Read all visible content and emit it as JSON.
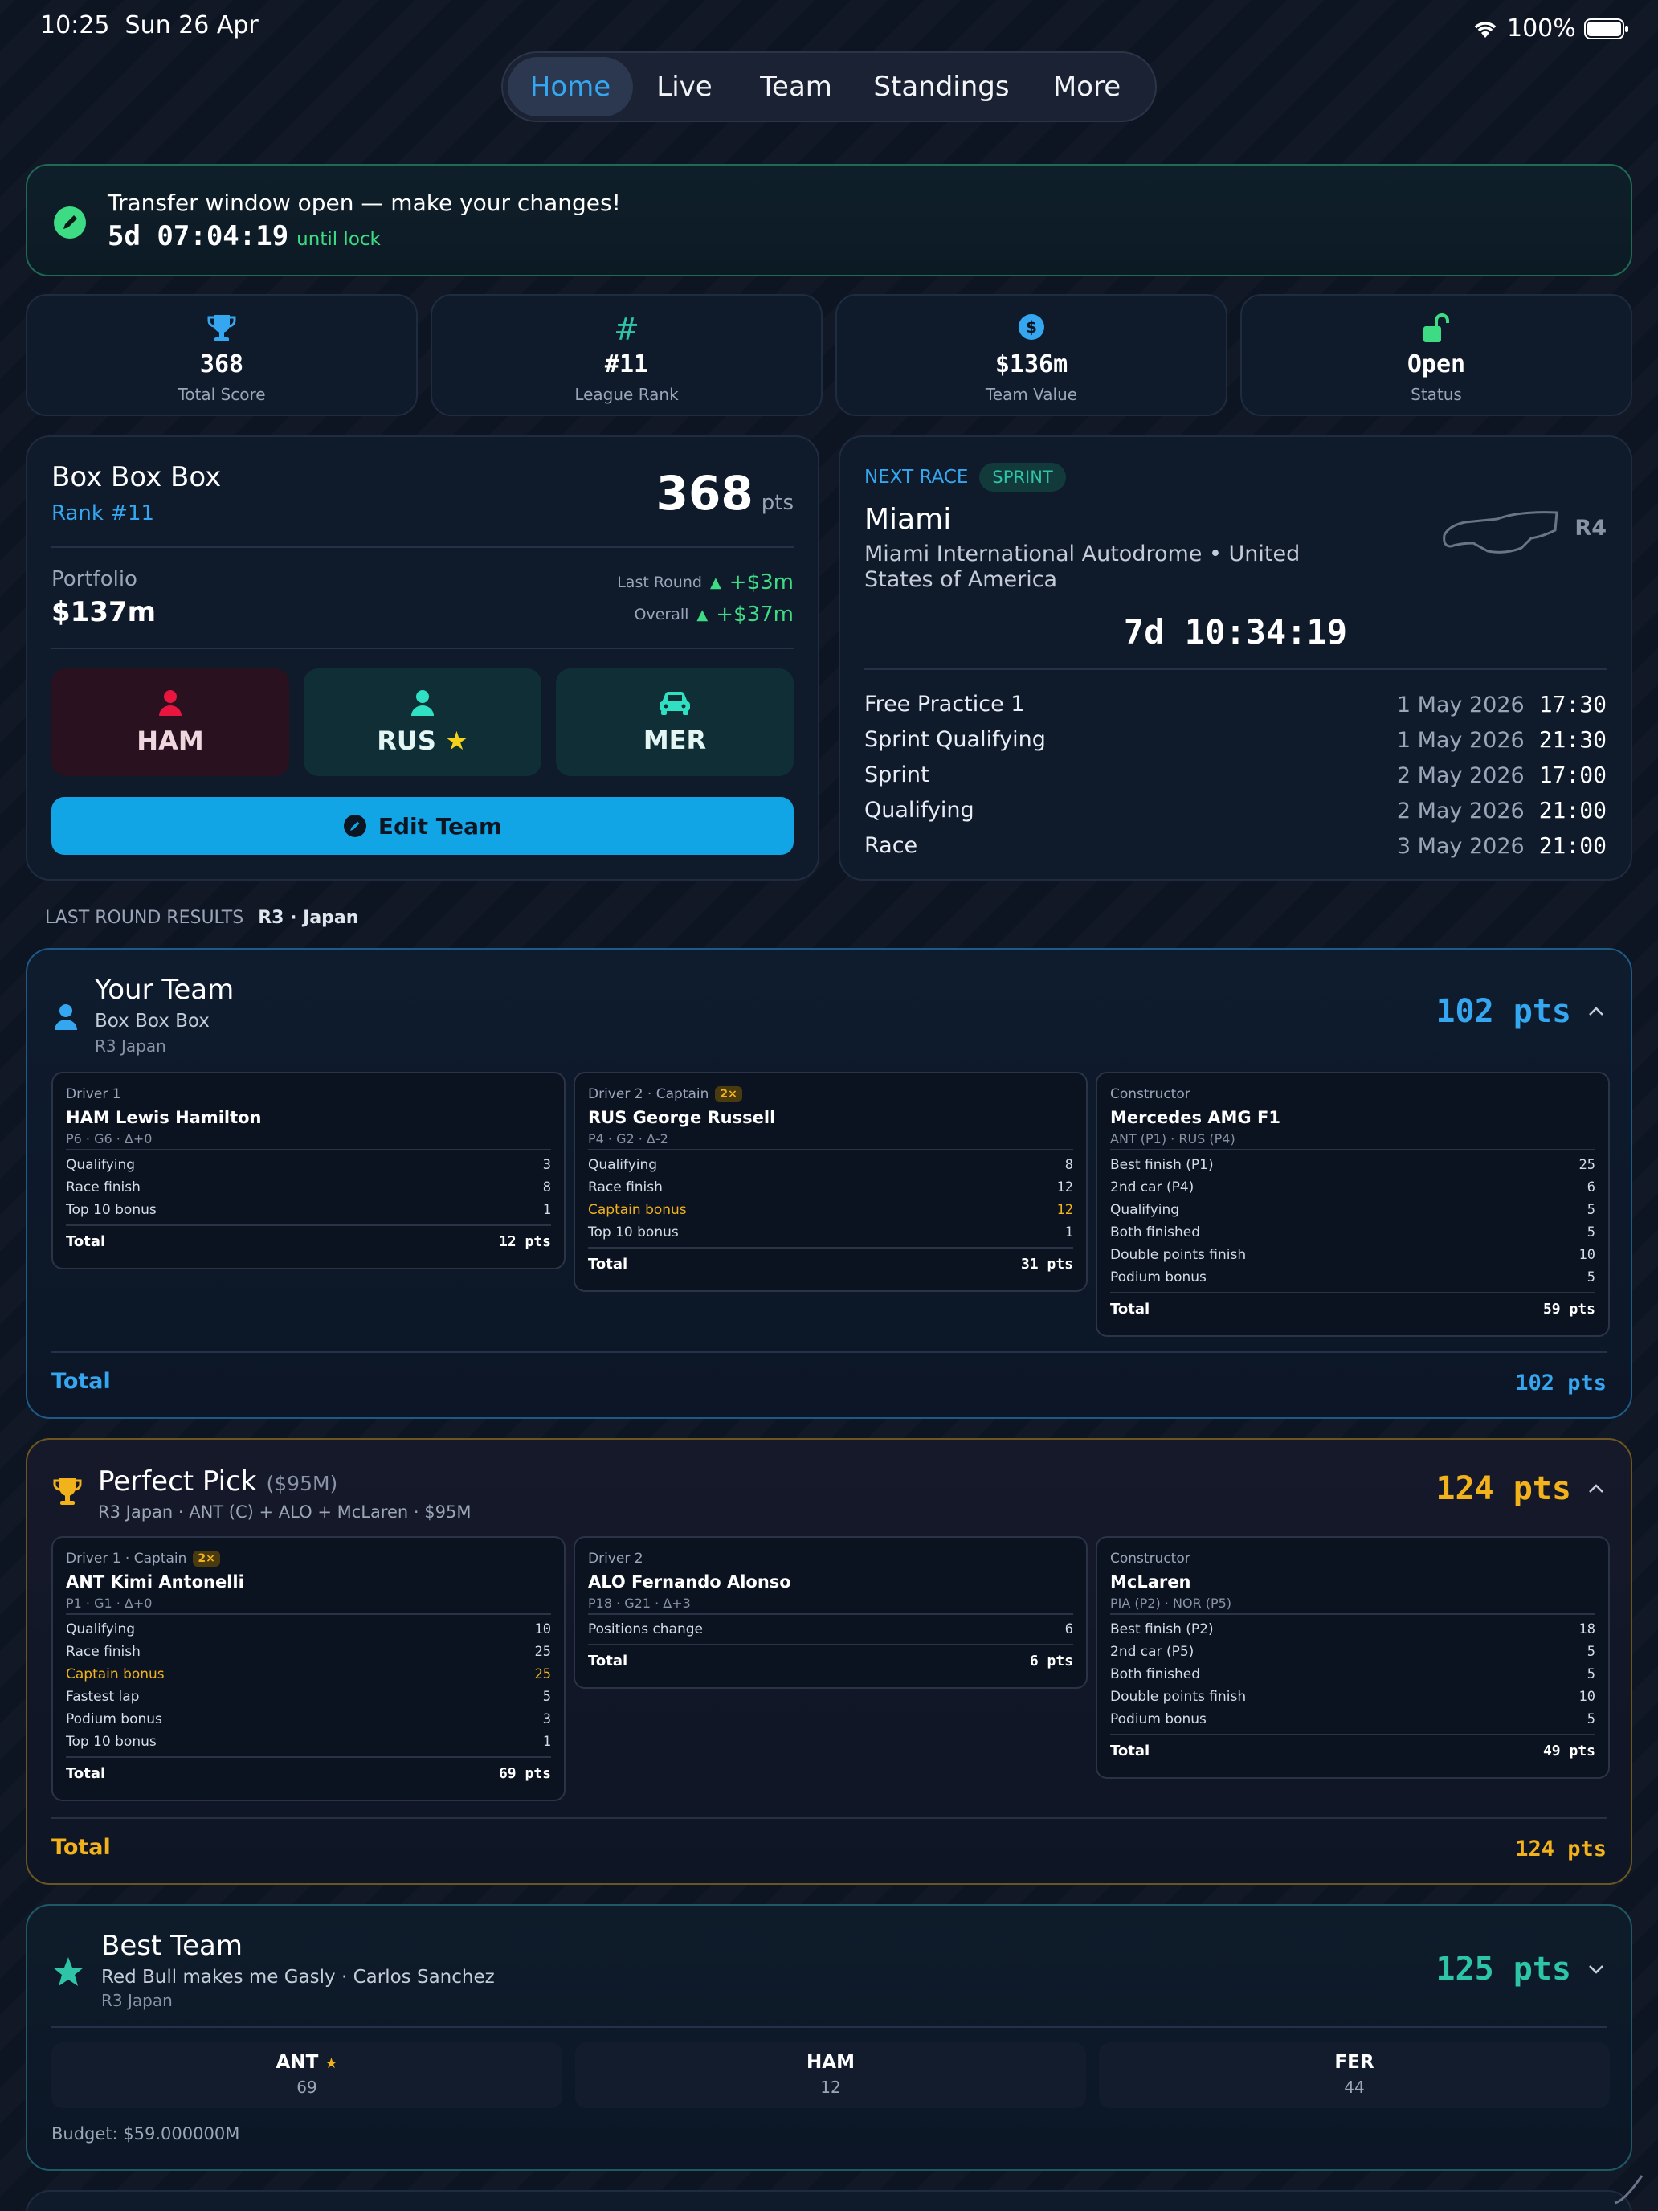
{
  "status_bar": {
    "time": "10:25",
    "date": "Sun 26 Apr",
    "battery": "100%"
  },
  "tabs": [
    {
      "label": "Home",
      "active": true
    },
    {
      "label": "Live"
    },
    {
      "label": "Team"
    },
    {
      "label": "Standings"
    },
    {
      "label": "More"
    }
  ],
  "transfer": {
    "message": "Transfer window open — make your changes!",
    "countdown": "5d 07:04:19",
    "suffix": "until lock"
  },
  "stats": [
    {
      "value": "368",
      "label": "Total Score",
      "icon": "trophy-icon"
    },
    {
      "value": "#11",
      "label": "League Rank",
      "icon": "hash-icon"
    },
    {
      "value": "$136m",
      "label": "Team Value",
      "icon": "dollar-icon"
    },
    {
      "value": "Open",
      "label": "Status",
      "icon": "unlock-icon"
    }
  ],
  "team_card": {
    "name": "Box Box Box",
    "rank": "Rank #11",
    "points": "368",
    "points_unit": "pts",
    "portfolio_label": "Portfolio",
    "portfolio_value": "$137m",
    "last_round_label": "Last Round",
    "last_round_value": "+$3m",
    "overall_label": "Overall",
    "overall_value": "+$37m",
    "chips": [
      {
        "code": "HAM",
        "icon": "person-icon"
      },
      {
        "code": "RUS",
        "icon": "person-icon",
        "captain": "★"
      },
      {
        "code": "MER",
        "icon": "car-icon"
      }
    ],
    "edit_label": "Edit Team"
  },
  "next_race": {
    "label": "NEXT RACE",
    "badge": "SPRINT",
    "name": "Miami",
    "venue": "Miami International Autodrome • United States of America",
    "round": "R4",
    "countdown": "7d 10:34:19",
    "sessions": [
      {
        "name": "Free Practice 1",
        "date": "1 May 2026",
        "time": "17:30"
      },
      {
        "name": "Sprint Qualifying",
        "date": "1 May 2026",
        "time": "21:30"
      },
      {
        "name": "Sprint",
        "date": "2 May 2026",
        "time": "17:00"
      },
      {
        "name": "Qualifying",
        "date": "2 May 2026",
        "time": "21:00"
      },
      {
        "name": "Race",
        "date": "3 May 2026",
        "time": "21:00"
      }
    ]
  },
  "last_round": {
    "label": "LAST ROUND RESULTS",
    "value": "R3 · Japan"
  },
  "your_team": {
    "title": "Your Team",
    "subtitle": "Box Box Box",
    "round": "R3 Japan",
    "points": "102 pts",
    "total_label": "Total",
    "total_value": "102 pts",
    "cards": [
      {
        "head": "Driver 1",
        "name": "HAM Lewis Hamilton",
        "meta": "P6 · G6 · Δ+0",
        "rows": [
          [
            "Qualifying",
            "3"
          ],
          [
            "Race finish",
            "8"
          ],
          [
            "Top 10 bonus",
            "1"
          ]
        ],
        "total": "12 pts"
      },
      {
        "head": "Driver 2 · Captain",
        "badge": "2×",
        "name": "RUS George Russell",
        "meta": "P4 · G2 · Δ-2",
        "rows": [
          [
            "Qualifying",
            "8"
          ],
          [
            "Race finish",
            "12"
          ],
          [
            "Captain bonus",
            "12"
          ],
          [
            "Top 10 bonus",
            "1"
          ]
        ],
        "total": "31 pts"
      },
      {
        "head": "Constructor",
        "name": "Mercedes AMG F1",
        "meta": "ANT (P1) · RUS (P4)",
        "rows": [
          [
            "Best finish (P1)",
            "25"
          ],
          [
            "2nd car (P4)",
            "6"
          ],
          [
            "Qualifying",
            "5"
          ],
          [
            "Both finished",
            "5"
          ],
          [
            "Double points finish",
            "10"
          ],
          [
            "Podium bonus",
            "5"
          ]
        ],
        "total": "59 pts"
      }
    ]
  },
  "perfect_pick": {
    "title": "Perfect Pick",
    "budget": "($95M)",
    "subtitle": "R3 Japan · ANT (C) + ALO + McLaren · $95M",
    "points": "124 pts",
    "total_label": "Total",
    "total_value": "124 pts",
    "cards": [
      {
        "head": "Driver 1 · Captain",
        "badge": "2×",
        "name": "ANT Kimi Antonelli",
        "meta": "P1 · G1 · Δ+0",
        "rows": [
          [
            "Qualifying",
            "10"
          ],
          [
            "Race finish",
            "25"
          ],
          [
            "Captain bonus",
            "25"
          ],
          [
            "Fastest lap",
            "5"
          ],
          [
            "Podium bonus",
            "3"
          ],
          [
            "Top 10 bonus",
            "1"
          ]
        ],
        "total": "69 pts"
      },
      {
        "head": "Driver 2",
        "name": "ALO Fernando Alonso",
        "meta": "P18 · G21 · Δ+3",
        "rows": [
          [
            "Positions change",
            "6"
          ]
        ],
        "total": "6 pts"
      },
      {
        "head": "Constructor",
        "name": "McLaren",
        "meta": "PIA (P2) · NOR (P5)",
        "rows": [
          [
            "Best finish (P2)",
            "18"
          ],
          [
            "2nd car (P5)",
            "5"
          ],
          [
            "Both finished",
            "5"
          ],
          [
            "Double points finish",
            "10"
          ],
          [
            "Podium bonus",
            "5"
          ]
        ],
        "total": "49 pts"
      }
    ]
  },
  "best_team": {
    "title": "Best Team",
    "subtitle": "Red Bull makes me Gasly · Carlos Sanchez",
    "round": "R3 Japan",
    "points": "125 pts",
    "picks": [
      {
        "code": "ANT",
        "star": "★",
        "value": "69"
      },
      {
        "code": "HAM",
        "value": "12"
      },
      {
        "code": "FER",
        "value": "44"
      }
    ],
    "budget": "Budget: $59.000000M"
  },
  "colors": {
    "accent_blue": "#35a7f0",
    "green": "#3ddc84",
    "gold": "#f2b21b",
    "teal": "#2ec4a8",
    "captain": "#f2b21b"
  }
}
